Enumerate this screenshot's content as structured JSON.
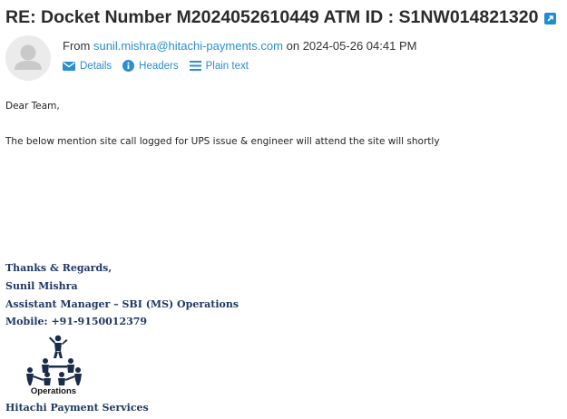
{
  "email": {
    "subject": "RE: Docket Number M2024052610449 ATM ID : S1NW014821320",
    "from_prefix": "From",
    "from_address": "sunil.mishra@hitachi-payments.com",
    "on_word": "on",
    "datetime": "2024-05-26 04:41 PM",
    "links": {
      "details": "Details",
      "headers": "Headers",
      "plain_text": "Plain text"
    },
    "body": {
      "greeting": "Dear Team,",
      "message": "The below mention site call logged for UPS issue & engineer will attend the site will shortly"
    },
    "signature": {
      "closing": "Thanks & Regards,",
      "name": "Sunil Mishra",
      "title": "Assistant Manager – SBI (MS) Operations",
      "mobile": "Mobile: +91-9150012379",
      "logo_text": "Operations",
      "company": "Hitachi Payment Services"
    }
  },
  "colors": {
    "link": "#2a8fcf",
    "signature": "#1f3864",
    "subject": "#2b2b2b"
  },
  "icons": [
    "external-link-icon",
    "avatar-placeholder-icon",
    "envelope-icon",
    "info-icon",
    "list-icon"
  ]
}
